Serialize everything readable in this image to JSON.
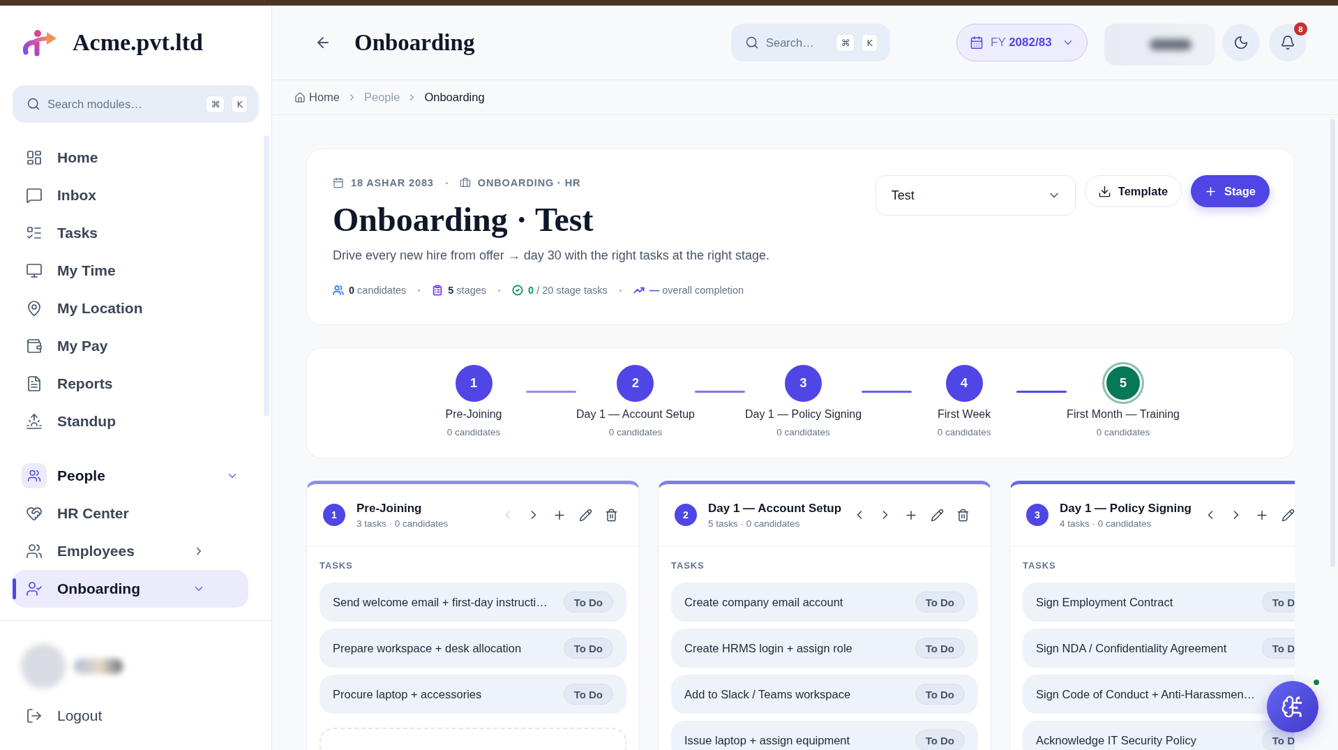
{
  "sidebar": {
    "brand": "Acme.pvt.ltd",
    "search": {
      "placeholder": "Search modules…",
      "keys": [
        "⌘",
        "K"
      ]
    },
    "nav": [
      {
        "label": "Home",
        "selected": false
      },
      {
        "label": "Inbox",
        "selected": false
      },
      {
        "label": "Tasks",
        "selected": false
      },
      {
        "label": "My Time",
        "selected": false
      },
      {
        "label": "My Location",
        "selected": false
      },
      {
        "label": "My Pay",
        "selected": false
      },
      {
        "label": "Reports",
        "selected": false
      },
      {
        "label": "Standup",
        "selected": false
      }
    ],
    "section": {
      "label": "People",
      "expanded": true,
      "items": [
        {
          "label": "HR Center",
          "kind": "link",
          "selected": false
        },
        {
          "label": "Employees",
          "kind": "group",
          "expanded": false,
          "selected": false
        },
        {
          "label": "Onboarding",
          "kind": "group",
          "expanded": true,
          "selected": true
        }
      ]
    },
    "logout": "Logout"
  },
  "header": {
    "title": "Onboarding",
    "search": {
      "placeholder": "Search…",
      "keys": [
        "⌘",
        "K"
      ]
    },
    "fiscal_year": {
      "prefix": "FY",
      "value": "2082/83"
    },
    "notifications": "8"
  },
  "breadcrumb": [
    {
      "label": "Home",
      "kind": "home",
      "current": false
    },
    {
      "label": "People",
      "kind": "link",
      "current": false
    },
    {
      "label": "Onboarding",
      "kind": "link",
      "current": true
    }
  ],
  "overview": {
    "date": "18 ASHAR 2083",
    "context": "ONBOARDING · HR",
    "title": "Onboarding · Test",
    "description": "Drive every new hire from offer → day 30 with the right tasks at the right stage.",
    "stats": [
      {
        "value": "0",
        "label": "candidates",
        "color": "#3b82f6",
        "kind": "count"
      },
      {
        "value": "5",
        "label": "stages",
        "color": "#7c3aed",
        "kind": "count"
      },
      {
        "value": "0",
        "label": "/ 20 stage tasks",
        "color": "#059669",
        "kind": "metric"
      },
      {
        "value": "—",
        "label": "overall completion",
        "color": "#4f46e5",
        "kind": "metric"
      }
    ],
    "select": {
      "value": "Test"
    },
    "template_button": "Template",
    "stage_button": "Stage"
  },
  "stepper": {
    "stages": [
      {
        "number": "1",
        "name": "Pre-Joining",
        "candidates": "0 candidates",
        "color": "#4f46e5",
        "selected": false
      },
      {
        "number": "2",
        "name": "Day 1 — Account Setup",
        "candidates": "0 candidates",
        "color": "#4f46e5",
        "selected": false
      },
      {
        "number": "3",
        "name": "Day 1 — Policy Signing",
        "candidates": "0 candidates",
        "color": "#4f46e5",
        "selected": false
      },
      {
        "number": "4",
        "name": "First Week",
        "candidates": "0 candidates",
        "color": "#4f46e5",
        "selected": false
      },
      {
        "number": "5",
        "name": "First Month — Training",
        "candidates": "0 candidates",
        "color": "#047857",
        "selected": true
      }
    ]
  },
  "board": {
    "columns": [
      {
        "number": "1",
        "name": "Pre-Joining",
        "meta": "3 tasks · 0 candidates",
        "color": "#8b90ea",
        "can_move_left": false,
        "cut_off": false,
        "section": "TASKS",
        "add_slot": true,
        "tasks": [
          {
            "title": "Send welcome email + first-day instructi…",
            "status": "To Do"
          },
          {
            "title": "Prepare workspace + desk allocation",
            "status": "To Do"
          },
          {
            "title": "Procure laptop + accessories",
            "status": "To Do"
          }
        ]
      },
      {
        "number": "2",
        "name": "Day 1 — Account Setup",
        "meta": "5 tasks · 0 candidates",
        "color": "#7b7fea",
        "can_move_left": true,
        "cut_off": false,
        "section": "TASKS",
        "tasks": [
          {
            "title": "Create company email account",
            "status": "To Do"
          },
          {
            "title": "Create HRMS login + assign role",
            "status": "To Do"
          },
          {
            "title": "Add to Slack / Teams workspace",
            "status": "To Do"
          },
          {
            "title": "Issue laptop + assign equipment",
            "status": "To Do"
          }
        ]
      },
      {
        "number": "3",
        "name": "Day 1 — Policy Signing",
        "meta": "4 tasks · 0 candidates",
        "color": "#6467e8",
        "can_move_left": true,
        "cut_off": true,
        "section": "TASKS",
        "tasks": [
          {
            "title": "Sign Employment Contract",
            "status": "To D"
          },
          {
            "title": "Sign NDA / Confidentiality Agreement",
            "status": "To D"
          },
          {
            "title": "Sign Code of Conduct + Anti-Harassmen…"
          },
          {
            "title": "Acknowledge IT Security Policy",
            "status": "To D"
          }
        ]
      }
    ]
  },
  "assistant": {
    "online": true
  }
}
